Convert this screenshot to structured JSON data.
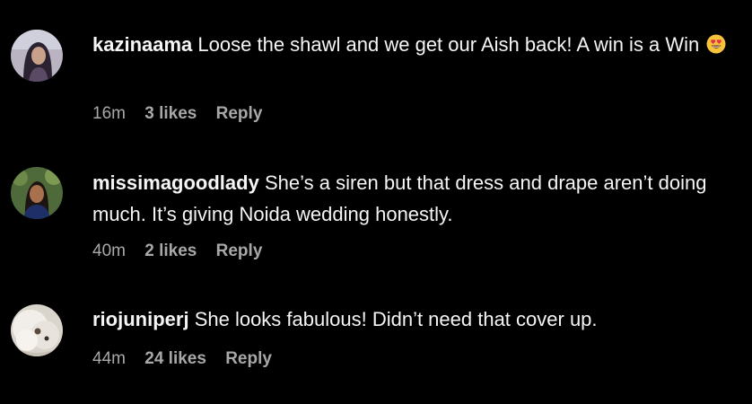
{
  "comments": [
    {
      "username": "kazinaama",
      "text": "Loose the shawl and we get our Aish back! A win is a Win",
      "emoji": "heart-eyes-emoji",
      "time": "16m",
      "likes": "3 likes",
      "reply": "Reply"
    },
    {
      "username": "missimagoodlady",
      "text": "She’s a siren but that dress and drape aren’t doing much. It’s giving Noida wedding honestly.",
      "time": "40m",
      "likes": "2 likes",
      "reply": "Reply"
    },
    {
      "username": "riojuniperj",
      "text": "She looks fabulous! Didn’t need that cover up.",
      "time": "44m",
      "likes": "24 likes",
      "reply": "Reply"
    }
  ],
  "colors": {
    "background": "#000000",
    "primary_text": "#f5f5f5",
    "secondary_text": "#a8a8a8"
  }
}
